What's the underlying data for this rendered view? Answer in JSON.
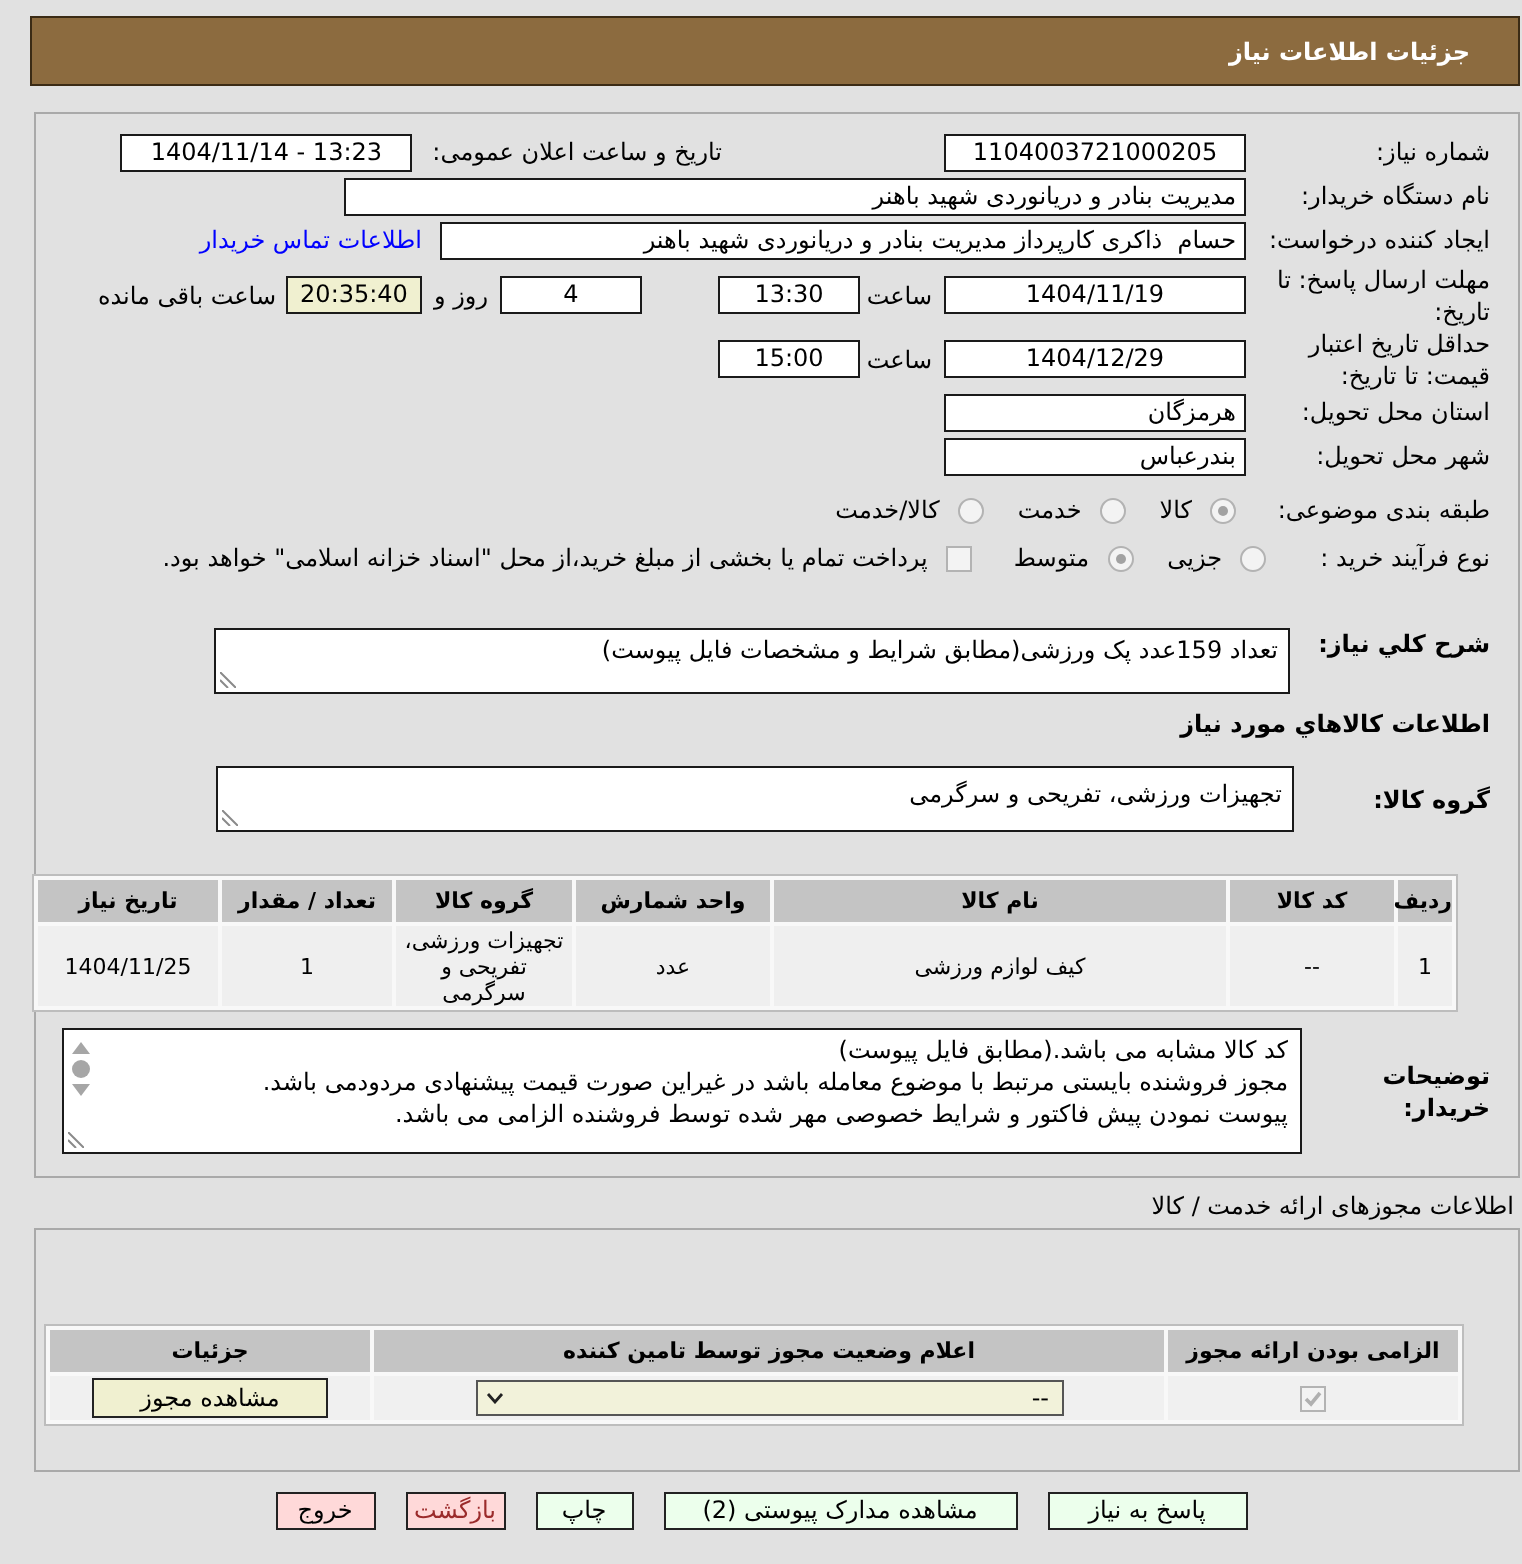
{
  "header": {
    "title": "جزئیات اطلاعات نیاز"
  },
  "details": {
    "need_number": {
      "label": "شماره نیاز:",
      "value": "1104003721000205"
    },
    "announcement": {
      "label": "تاریخ و ساعت اعلان عمومی:",
      "value": "1404/11/14 - 13:23"
    },
    "buyer_org": {
      "label": "نام دستگاه خریدار:",
      "value": "مدیریت بنادر و دریانوردی شهید باهنر"
    },
    "requester": {
      "label": "ایجاد کننده درخواست:",
      "value": "حسام  ذاکری کارپرداز مدیریت بنادر و دریانوردی شهید باهنر",
      "contact_link": "اطلاعات تماس خریدار"
    },
    "reply_deadline": {
      "label": "مهلت ارسال پاسخ: تا تاریخ:",
      "date": "1404/11/19",
      "time_label": "ساعت",
      "time": "13:30",
      "days": "4",
      "days_label": "روز و",
      "remaining": "20:35:40",
      "remaining_label": "ساعت باقی مانده"
    },
    "price_validity": {
      "label": "حداقل تاریخ اعتبار قیمت: تا تاریخ:",
      "date": "1404/12/29",
      "time_label": "ساعت",
      "time": "15:00"
    },
    "delivery_province": {
      "label": "استان محل تحویل:",
      "value": "هرمزگان"
    },
    "delivery_city": {
      "label": "شهر محل تحویل:",
      "value": "بندرعباس"
    },
    "subject_category": {
      "label": "طبقه بندی موضوعی:",
      "disabled": true,
      "options": [
        {
          "label": "کالا",
          "selected": true
        },
        {
          "label": "خدمت",
          "selected": false
        },
        {
          "label": "کالا/خدمت",
          "selected": false
        }
      ]
    },
    "purchase_process": {
      "label": "نوع فرآیند خرید :",
      "disabled": true,
      "options": [
        {
          "label": "جزیی",
          "selected": false
        },
        {
          "label": "متوسط",
          "selected": true
        }
      ],
      "treasury_payment": {
        "label": "پرداخت تمام یا بخشی از مبلغ خرید،از محل \"اسناد خزانه اسلامی\" خواهد بود.",
        "checked": false,
        "disabled": true
      }
    },
    "summary": {
      "label": "شرح کلي نياز:",
      "value": "تعداد 159عدد پک ورزشی(مطابق شرایط و مشخصات فایل پیوست)"
    },
    "goods_heading": "اطلاعات كالاهاي مورد نياز",
    "goods_group": {
      "label": "گروه کالا:",
      "value": "تجهیزات ورزشی، تفریحی و سرگرمی"
    },
    "goods_table": {
      "columns": [
        "ردیف",
        "کد کالا",
        "نام کالا",
        "واحد شمارش",
        "گروه کالا",
        "تعداد / مقدار",
        "تاریخ نیاز"
      ],
      "rows": [
        [
          "1",
          "--",
          "کیف لوازم ورزشی",
          "عدد",
          "تجهیزات ورزشی، تفریحی و سرگرمی",
          "1",
          "1404/11/25"
        ]
      ]
    },
    "buyer_notes": {
      "label": "توضیحات خریدار:",
      "value": "کد کالا مشابه می باشد.(مطابق فایل پیوست)\nمجوز فروشنده بایستی مرتبط با موضوع معامله باشد در غیراین صورت قیمت پیشنهادی مردودمی باشد.\nپیوست نمودن پیش فاکتور و شرایط خصوصی مهر شده توسط فروشنده الزامی می باشد."
    }
  },
  "licenses": {
    "title": "اطلاعات مجوزهای ارائه خدمت / کالا",
    "table": {
      "columns": [
        "الزامی بودن ارائه مجوز",
        "اعلام وضعیت مجوز توسط تامین کننده",
        "جزئیات"
      ],
      "rows": [
        {
          "required": true,
          "disabled": true,
          "status": "--",
          "details_button": "مشاهده مجوز"
        }
      ]
    }
  },
  "buttons": [
    {
      "label": "پاسخ به نیاز",
      "kind": "reply"
    },
    {
      "label": "مشاهده مدارک پیوستی (2)",
      "kind": "attachments"
    },
    {
      "label": "چاپ",
      "kind": "print"
    },
    {
      "label": "بازگشت",
      "kind": "back"
    },
    {
      "label": "خروج",
      "kind": "exit"
    }
  ]
}
